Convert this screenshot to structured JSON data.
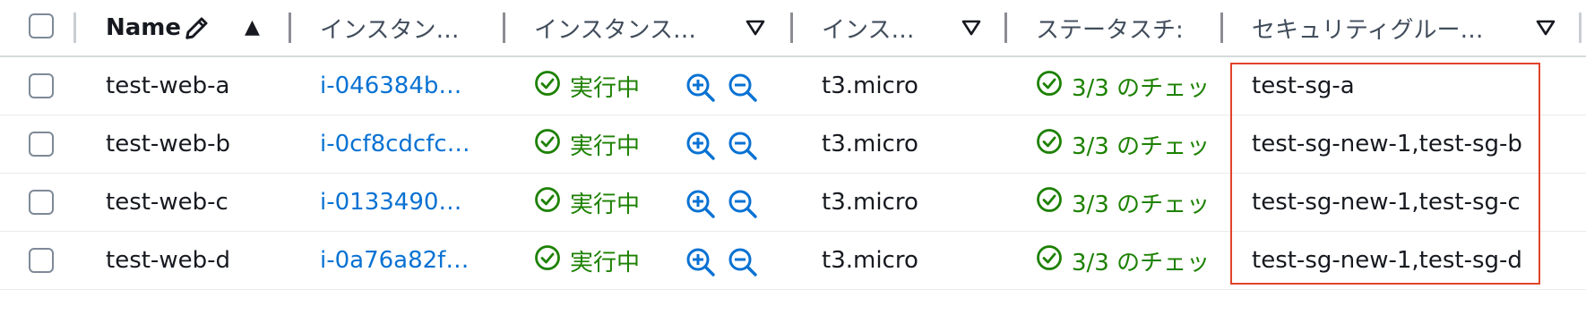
{
  "header": {
    "name": "Name",
    "instance_id": "インスタン…",
    "instance_state": "インスタンス…",
    "instance_type": "インス…",
    "status_check": "ステータスチ:",
    "security_group": "セキュリティグルー…"
  },
  "rows": [
    {
      "name": "test-web-a",
      "id": "i-046384b…",
      "state": "実行中",
      "type": "t3.micro",
      "check": "3/3 のチェッ",
      "sg": "test-sg-a"
    },
    {
      "name": "test-web-b",
      "id": "i-0cf8cdcfc…",
      "state": "実行中",
      "type": "t3.micro",
      "check": "3/3 のチェッ",
      "sg": "test-sg-new-1,test-sg-b"
    },
    {
      "name": "test-web-c",
      "id": "i-0133490…",
      "state": "実行中",
      "type": "t3.micro",
      "check": "3/3 のチェッ",
      "sg": "test-sg-new-1,test-sg-c"
    },
    {
      "name": "test-web-d",
      "id": "i-0a76a82f…",
      "state": "実行中",
      "type": "t3.micro",
      "check": "3/3 のチェッ",
      "sg": "test-sg-new-1,test-sg-d"
    }
  ],
  "colors": {
    "link": "#0972d3",
    "success": "#1d8102",
    "highlight_border": "#e0442a"
  }
}
